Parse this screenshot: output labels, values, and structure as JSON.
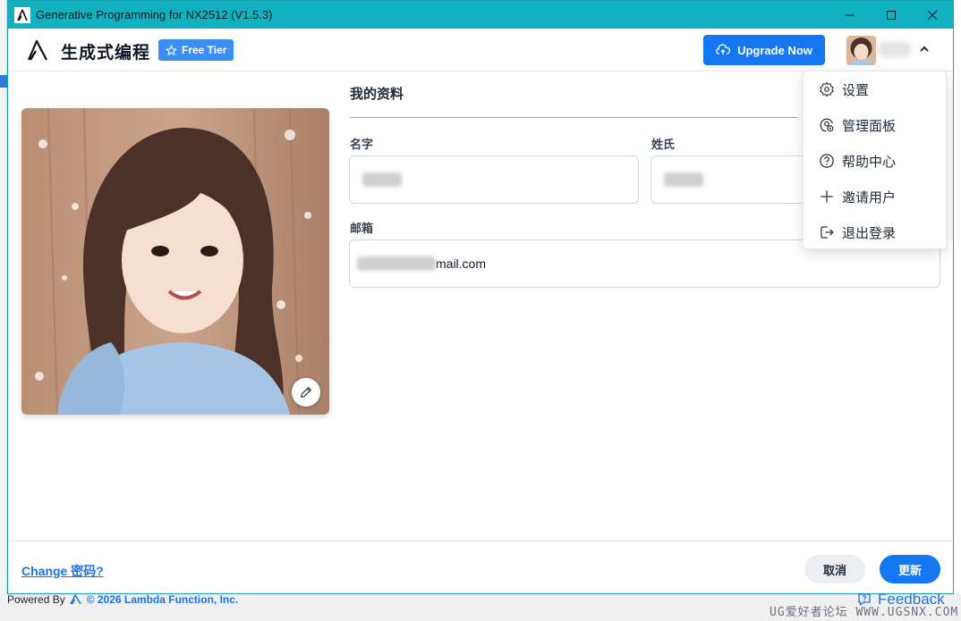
{
  "window": {
    "title": "Generative Programming for NX2512 (V1.5.3)",
    "controls": [
      "minimize-icon",
      "maximize-icon",
      "close-icon"
    ]
  },
  "header": {
    "brand_name": "生成式编程",
    "tier_badge": "Free Tier",
    "upgrade_label": "Upgrade Now"
  },
  "profile": {
    "title": "我的资料",
    "first_name_label": "名字",
    "last_name_label": "姓氏",
    "email_label": "邮箱",
    "email_visible_suffix": "mail.com"
  },
  "menu": {
    "items": [
      {
        "label": "设置",
        "icon": "gear-icon"
      },
      {
        "label": "管理面板",
        "icon": "admin-panel-icon"
      },
      {
        "label": "帮助中心",
        "icon": "help-icon"
      },
      {
        "label": "邀请用户",
        "icon": "plus-icon"
      },
      {
        "label": "退出登录",
        "icon": "logout-icon"
      }
    ]
  },
  "footer": {
    "change_password": "Change 密码?",
    "cancel": "取消",
    "update": "更新",
    "powered_by": "Powered By",
    "copyright": "© 2026 Lambda Function, Inc.",
    "feedback": "Feedback"
  },
  "watermark": "UG爱好者论坛 WWW.UGSNX.COM",
  "colors": {
    "titlebar": "#12b1c1",
    "primary": "#1677f2",
    "link": "#1a73e8",
    "badge": "#3b8ff0"
  }
}
